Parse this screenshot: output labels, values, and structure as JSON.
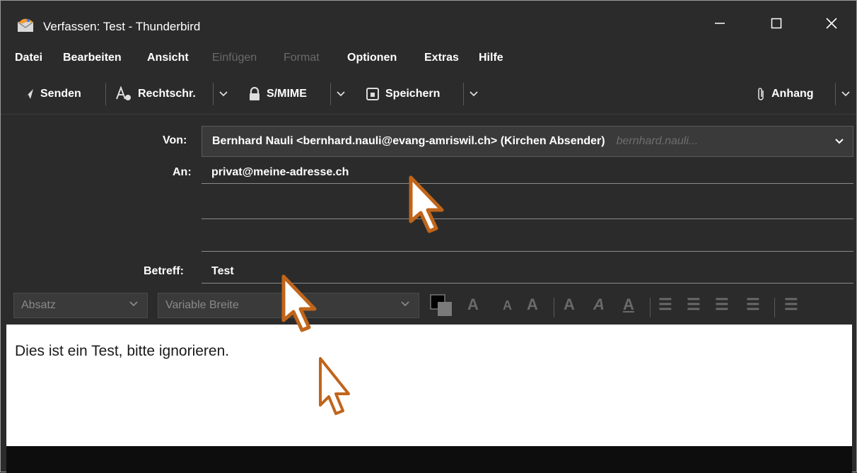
{
  "window": {
    "title": "Verfassen: Test - Thunderbird",
    "controls": [
      "minimize-icon",
      "maximize-icon",
      "close-icon"
    ]
  },
  "menu": {
    "items": [
      {
        "label": "Datei",
        "enabled": true
      },
      {
        "label": "Bearbeiten",
        "enabled": true
      },
      {
        "label": "Ansicht",
        "enabled": true
      },
      {
        "label": "Einfügen",
        "enabled": false
      },
      {
        "label": "Format",
        "enabled": false
      },
      {
        "label": "Optionen",
        "enabled": true
      },
      {
        "label": "Extras",
        "enabled": true
      },
      {
        "label": "Hilfe",
        "enabled": true
      }
    ]
  },
  "toolbar": {
    "send_label": "Senden",
    "spell_label": "Rechtschr.",
    "smime_label": "S/MIME",
    "save_label": "Speichern",
    "attach_label": "Anhang"
  },
  "header": {
    "from_label": "Von:",
    "from_value": "Bernhard Nauli <bernhard.nauli@evang-amriswil.ch> (Kirchen Absender)",
    "from_hint": "bernhard.nauli...",
    "to_label": "An:",
    "to_value": "privat@meine-adresse.ch",
    "subject_label": "Betreff:",
    "subject_value": "Test"
  },
  "format": {
    "paragraph": "Absatz",
    "font": "Variable Breite"
  },
  "body": {
    "text": "Dies ist ein Test, bitte ignorieren."
  },
  "colors": {
    "background": "#2b2b2b",
    "cursor_accent": "#c0651a"
  }
}
